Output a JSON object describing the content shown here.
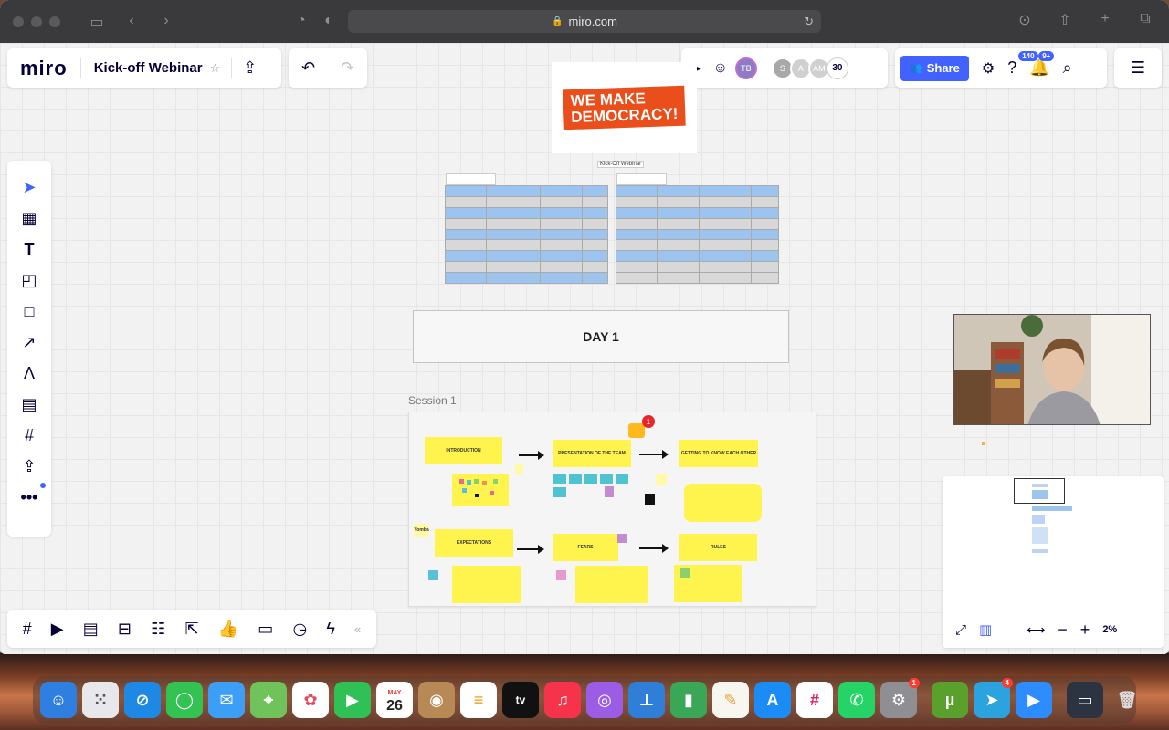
{
  "browser": {
    "url": "miro.com"
  },
  "app": {
    "logo": "miro",
    "board_title": "Kick-off Webinar"
  },
  "topbar": {
    "collaborators": [
      {
        "initials": "TB",
        "color": "#8e7cc3"
      },
      {
        "initials": "S",
        "color": "#b0b0b0"
      },
      {
        "initials": "A",
        "color": "#c9c9c9"
      },
      {
        "initials": "AM",
        "color": "#c9c9c9"
      }
    ],
    "collaborator_count": "30",
    "share_label": "Share",
    "help_badge": "140",
    "notifications_badge": "9+"
  },
  "board": {
    "logo_text_line1": "WE MAKE",
    "logo_text_line2": "DEMOCRACY!",
    "schedule_title": "Kick-Off Webinar",
    "day_label": "DAY 1",
    "frame_title": "Session 1",
    "stickies": {
      "introduction": "INTRODUCTION",
      "presentation": "PRESENTATION OF THE TEAM",
      "getting_to_know": "GETTING TO KNOW EACH OTHER",
      "expectations": "EXPECTATIONS",
      "fears": "FEARS",
      "rules": "RULES",
      "small_note": "Yomba"
    },
    "comment_count": "1"
  },
  "zoom": {
    "level": "2%"
  },
  "dock": {
    "calendar_month": "MAY",
    "calendar_day": "26",
    "settings_badge": "1",
    "telegram_badge": "4"
  },
  "colors": {
    "accent": "#4262ff",
    "sticky_yellow": "#fff34d",
    "logo_red": "#e94e1b",
    "schedule_blue": "#9dc3ef"
  }
}
